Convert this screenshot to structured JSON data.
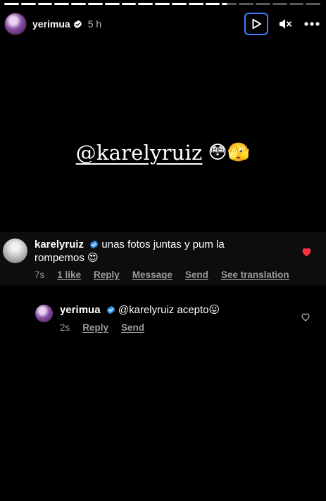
{
  "story": {
    "progress_segments": [
      1,
      1,
      1,
      1,
      1,
      1,
      1,
      1,
      1,
      1,
      1,
      1,
      1,
      0,
      0,
      0,
      0,
      0,
      0
    ],
    "progress_current_fill": 0.3
  },
  "header": {
    "username": "yerimua",
    "time": "5 h"
  },
  "caption": {
    "mention": "@karelyruiz",
    "emojis": "😳🫣"
  },
  "comments": [
    {
      "username": "karelyruiz",
      "text": "unas fotos juntas y pum la rompemos",
      "emoji": "😍",
      "timestamp": "7s",
      "likes": "1 like",
      "actions": [
        "Reply",
        "Message",
        "Send",
        "See translation"
      ],
      "liked": true
    },
    {
      "username": "yerimua",
      "text": "@karelyruiz acepto",
      "emoji": "😛",
      "timestamp": "2s",
      "actions": [
        "Reply",
        "Send"
      ],
      "liked": false
    }
  ],
  "colors": {
    "verified": "#3897f0",
    "like_red": "#ff3040",
    "focus_ring": "#3d7cff"
  }
}
